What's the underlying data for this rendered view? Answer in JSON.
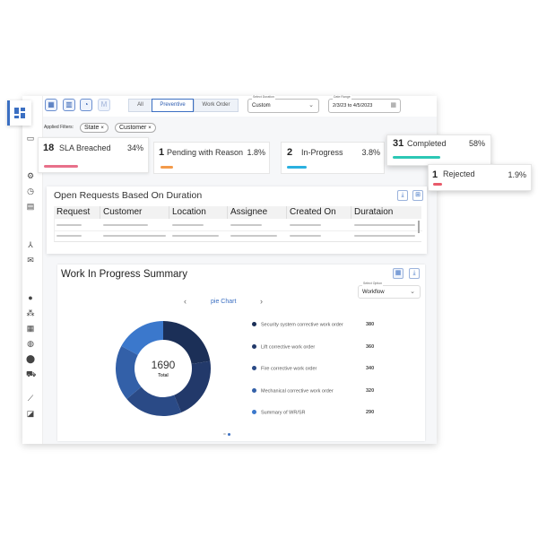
{
  "toolbar": {
    "view_icons": [
      "dashboard-icon",
      "calendar-icon",
      "chart-icon",
      "mail-icon"
    ],
    "segments": [
      {
        "label": "All",
        "active": false
      },
      {
        "label": "Preventive",
        "active": true
      },
      {
        "label": "Work Order",
        "active": false
      }
    ],
    "duration": {
      "label": "Select Duration",
      "value": "Custom"
    },
    "date_range": {
      "label": "Date Range",
      "value": "2/3/23 to 4/5/2023"
    }
  },
  "filters": {
    "label": "Applied Filters:",
    "chips": [
      "State",
      "Customer"
    ]
  },
  "status_cards": [
    {
      "count": "18",
      "label": "SLA Breached",
      "percent": "34%",
      "color": "#e8708a"
    },
    {
      "count": "1",
      "label": "Pending with Reason",
      "percent": "1.8%",
      "color": "#f39a4a"
    },
    {
      "count": "2",
      "label": "In-Progress",
      "percent": "3.8%",
      "color": "#2ab0e0"
    },
    {
      "count": "31",
      "label": "Completed",
      "percent": "58%",
      "color": "#2cc7b5"
    },
    {
      "count": "1",
      "label": "Rejected",
      "percent": "1.9%",
      "color": "#e85a6a"
    }
  ],
  "open_requests": {
    "title": "Open Requests Based On Duration",
    "columns": [
      "Request",
      "Customer",
      "Location",
      "Assignee",
      "Created On",
      "Durataion"
    ]
  },
  "wip": {
    "title": "Work In Progress Summary",
    "select": {
      "label": "Select Option",
      "value": "Workflow"
    },
    "chart_nav_label": "pie Chart",
    "total": "1690",
    "total_label": "Total"
  },
  "chart_data": {
    "type": "pie",
    "donut": true,
    "categories": [
      "Security system corrective work order",
      "Lift corrective work order",
      "Fire corrective work order",
      "Mechanical corrective work order",
      "Summary of WR/SR"
    ],
    "values": [
      380,
      360,
      340,
      320,
      290
    ],
    "colors": [
      "#1b2f57",
      "#22396a",
      "#2a4a86",
      "#3360a8",
      "#3b78cc"
    ],
    "legend": "right"
  },
  "accent": "#3b6fc2"
}
